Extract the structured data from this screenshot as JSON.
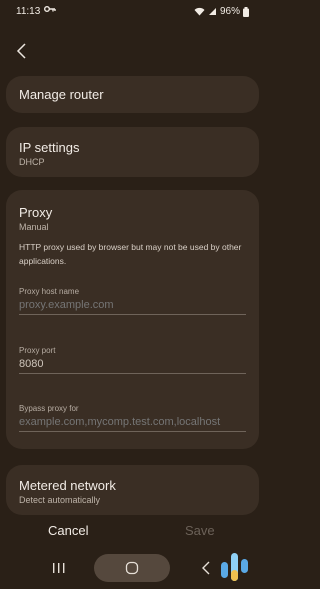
{
  "status": {
    "time": "11:13",
    "battery": "96%"
  },
  "sections": {
    "manage_router": {
      "label": "Manage router"
    },
    "ip_settings": {
      "title": "IP settings",
      "value": "DHCP"
    },
    "proxy": {
      "title": "Proxy",
      "value": "Manual",
      "description": "HTTP proxy used by browser but may not be used by other applications.",
      "host": {
        "label": "Proxy host name",
        "placeholder": "proxy.example.com"
      },
      "port": {
        "label": "Proxy port",
        "value": "8080"
      },
      "bypass": {
        "label": "Bypass proxy for",
        "placeholder": "example.com,mycomp.test.com,localhost"
      }
    },
    "metered": {
      "title": "Metered network",
      "value": "Detect automatically"
    }
  },
  "actions": {
    "cancel": "Cancel",
    "save": "Save"
  },
  "colors": {
    "background": "#2a2017",
    "card": "#3a2e24",
    "save_disabled": "#6b6158",
    "accent_blue": "#5aa9e6"
  }
}
